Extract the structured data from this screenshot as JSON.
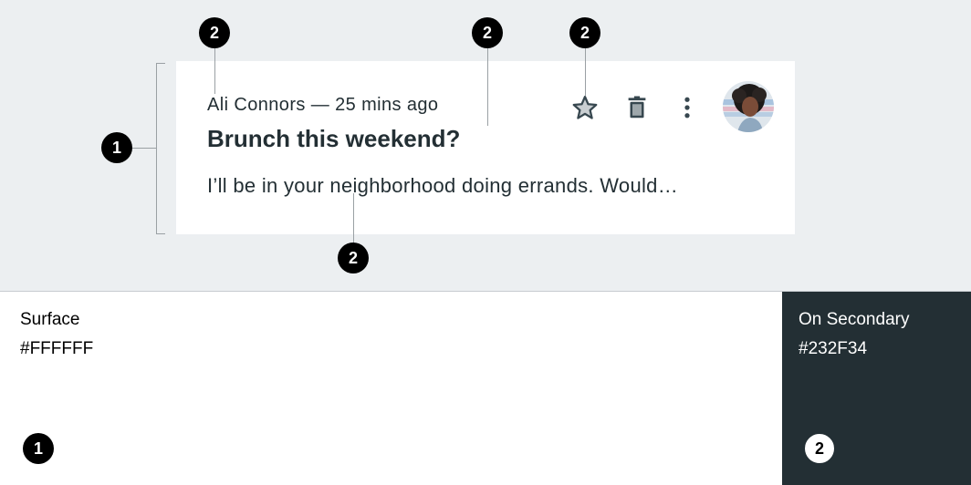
{
  "card": {
    "meta": "Ali Connors — 25 mins ago",
    "title": "Brunch this weekend?",
    "body": "I’ll be in your neighborhood doing errands. Would…",
    "actions": [
      "star-icon",
      "delete-icon",
      "more-vert-icon"
    ],
    "avatar": "avatar-image"
  },
  "annotations": {
    "container_marker": "1",
    "content_marker": "2"
  },
  "swatches": [
    {
      "name": "Surface",
      "hex": "#FFFFFF"
    },
    {
      "name": "On Secondary",
      "hex": "#232F34"
    }
  ],
  "colors": {
    "background": "#ECEFF1",
    "surface": "#FFFFFF",
    "on_secondary": "#232F34"
  }
}
